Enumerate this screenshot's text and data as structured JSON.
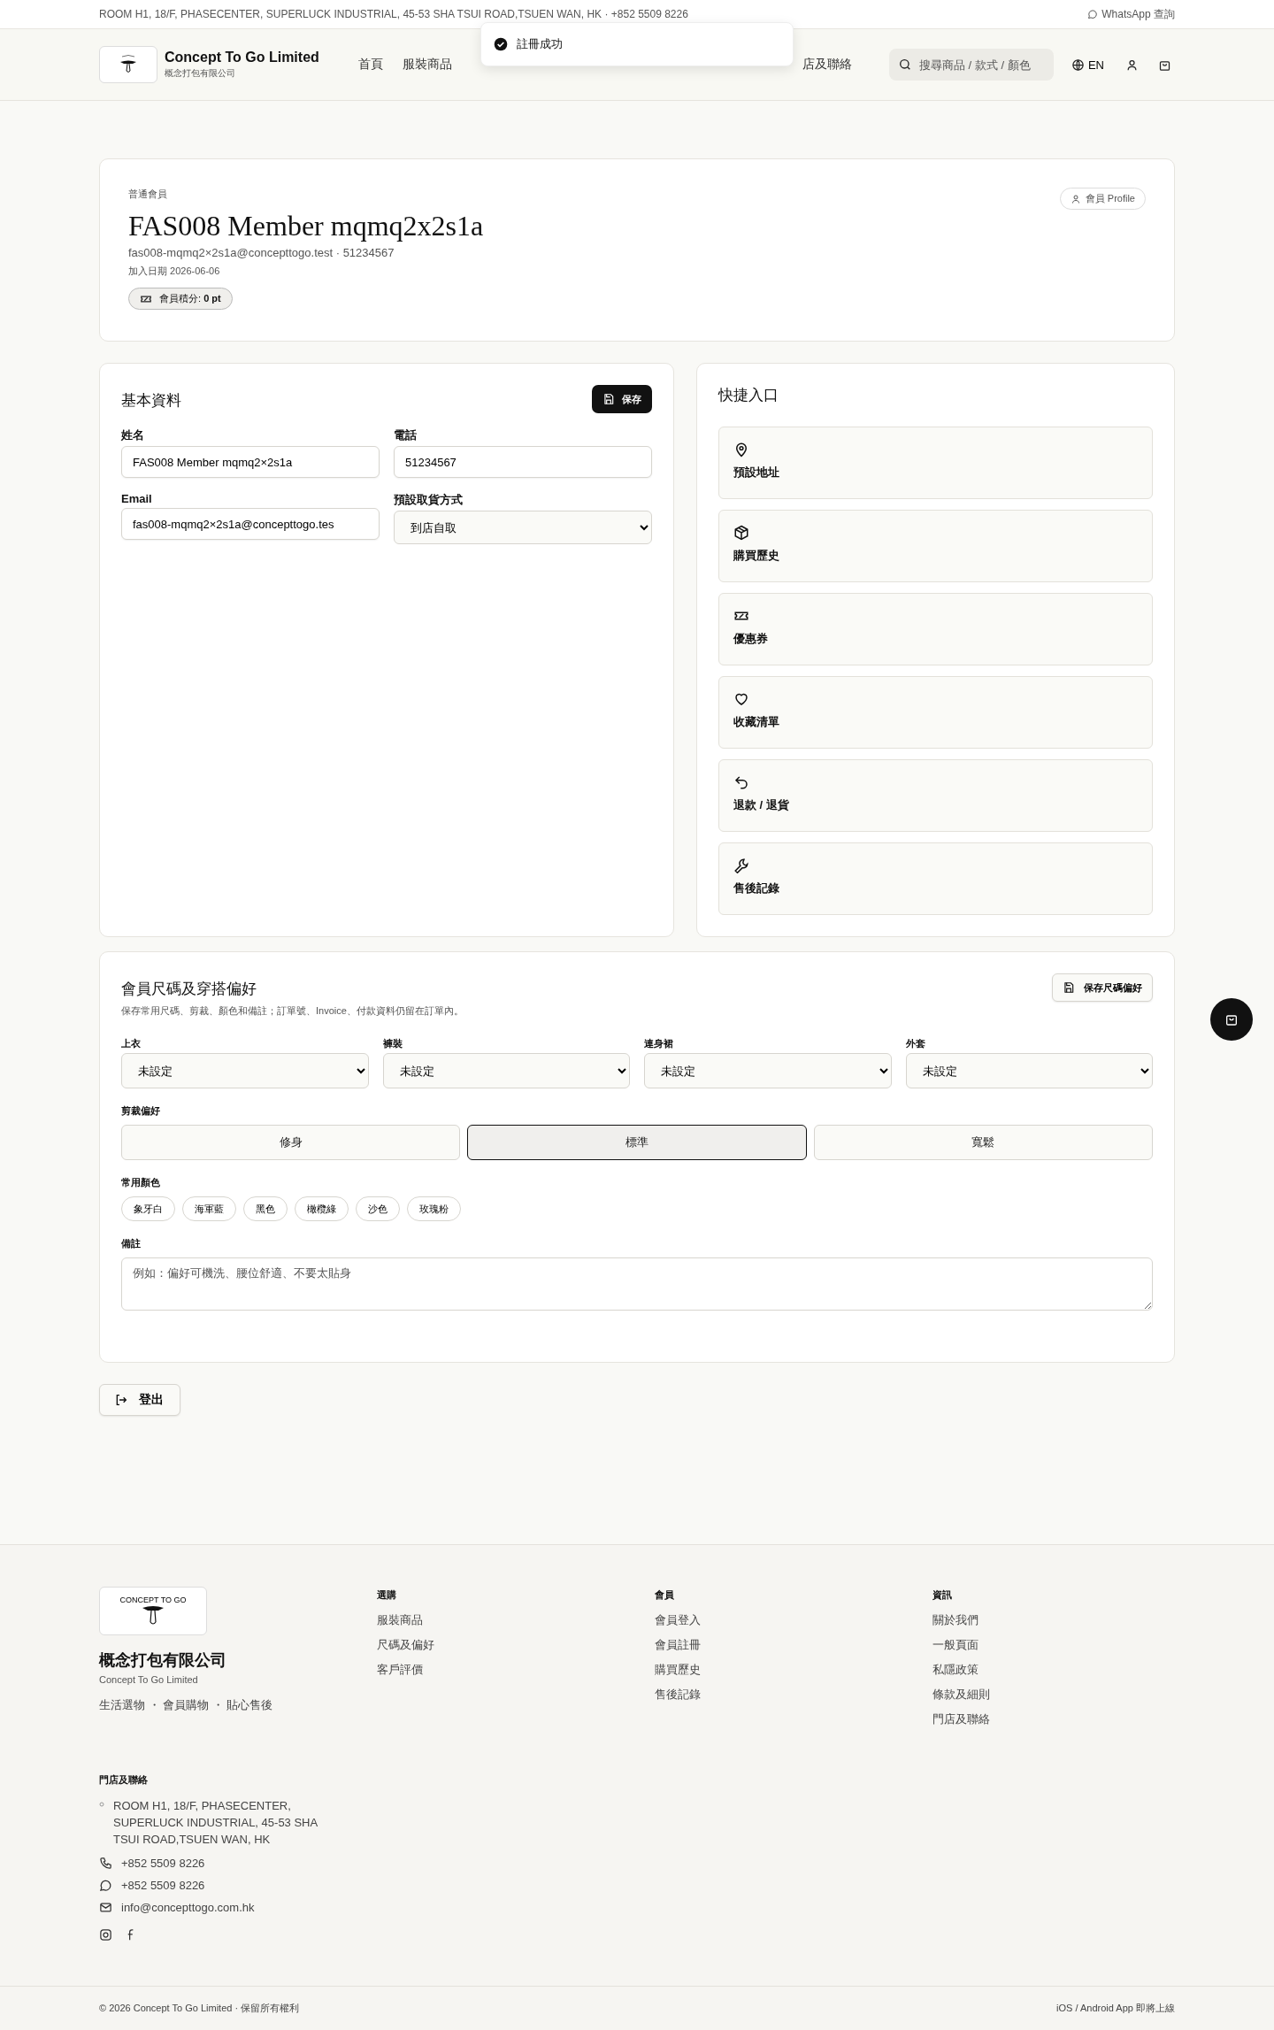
{
  "top_bar": {
    "address": "ROOM H1, 18/F, PHASECENTER, SUPERLUCK INDUSTRIAL, 45-53 SHA TSUI ROAD,TSUEN WAN, HK · +852 5509 8226",
    "whatsapp": "WhatsApp 查詢"
  },
  "toast": {
    "message": "註冊成功"
  },
  "header": {
    "brand": "Concept To Go Limited",
    "brand_sub": "概念打包有限公司",
    "nav": [
      "首頁",
      "服裝商品",
      "店及聯絡"
    ],
    "search": {
      "placeholder": "搜尋商品 / 款式 / 顏色"
    },
    "language": "EN"
  },
  "profile": {
    "tier": "普通會員",
    "name": "FAS008 Member mqmq2x2s1a",
    "contact": "fas008-mqmq2×2s1a@concepttogo.test · 51234567",
    "joined": "加入日期 2026-06-06",
    "points": "會員積分: **0 pt**",
    "profile_button": "會員 Profile"
  },
  "basic_info": {
    "title": "基本資料",
    "save_button": "保存",
    "fields": [
      {
        "label": "姓名",
        "value": "FAS008 Member mqmq2×2s1a",
        "kind": "text"
      },
      {
        "label": "電話",
        "value": "51234567",
        "kind": "text"
      },
      {
        "label": "Email",
        "value": "fas008-mqmq2×2s1a@concepttogo.tes",
        "kind": "text"
      },
      {
        "label": "預設取貨方式",
        "value": "到店自取",
        "kind": "select"
      }
    ]
  },
  "quick_links": {
    "title": "快捷入口",
    "items": [
      "預設地址",
      "購買歷史",
      "優惠券",
      "收藏清單",
      "退款 / 退貨",
      "售後記錄"
    ]
  },
  "preferences": {
    "title": "會員尺碼及穿搭偏好",
    "subtitle": "保存常用尺碼、剪裁、顏色和備註；訂單號、Invoice、付款資料仍留在訂單內。",
    "save_button": "保存尺碼偏好",
    "sizes": [
      {
        "label": "上衣",
        "value": "未設定"
      },
      {
        "label": "褲裝",
        "value": "未設定"
      },
      {
        "label": "連身裙",
        "value": "未設定"
      },
      {
        "label": "外套",
        "value": "未設定"
      }
    ],
    "fit_label": "剪裁偏好",
    "fits": [
      {
        "label": "修身",
        "selected": false
      },
      {
        "label": "標準",
        "selected": true
      },
      {
        "label": "寬鬆",
        "selected": false
      }
    ],
    "colors_label": "常用顏色",
    "colors": [
      "象牙白",
      "海軍藍",
      "黑色",
      "橄欖綠",
      "沙色",
      "玫瑰粉"
    ],
    "notes_label": "備註",
    "notes": {
      "placeholder": "例如：偏好可機洗、腰位舒適、不要太貼身"
    }
  },
  "logout_button": "登出",
  "footer": {
    "logo_text": "CONCEPT TO GO",
    "company": "概念打包有限公司",
    "company_en": "Concept To Go Limited",
    "tagline": "生活選物 ・ 會員購物 ・ 貼心售後",
    "columns": [
      {
        "heading": "選購",
        "links": [
          "服裝商品",
          "尺碼及偏好",
          "客戶評價"
        ]
      },
      {
        "heading": "會員",
        "links": [
          "會員登入",
          "會員註冊",
          "購買歷史",
          "售後記錄"
        ]
      },
      {
        "heading": "資訊",
        "links": [
          "關於我們",
          "一般頁面",
          "私隱政策",
          "條款及細則",
          "門店及聯絡"
        ]
      }
    ],
    "contact": {
      "heading": "門店及聯絡",
      "address": "ROOM H1, 18/F, PHASECENTER, SUPERLUCK INDUSTRIAL, 45-53 SHA TSUI ROAD,TSUEN WAN, HK",
      "phone": "+852 5509 8226",
      "whatsapp": "+852 5509 8226",
      "email": "info@concepttogo.com.hk"
    },
    "copyright": "© 2026 Concept To Go Limited · 保留所有權利",
    "app_note": "iOS / Android App 即將上線"
  }
}
